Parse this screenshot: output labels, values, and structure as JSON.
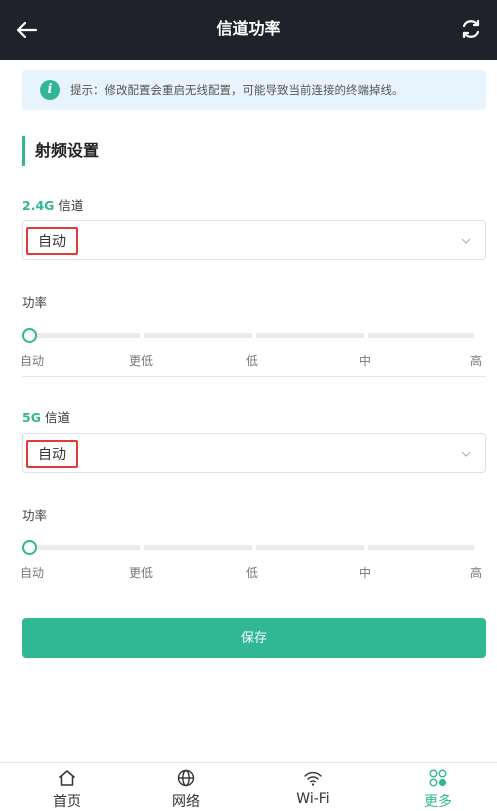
{
  "header": {
    "title": "信道功率",
    "back_icon": "back-arrow-icon",
    "refresh_icon": "refresh-icon"
  },
  "tip": {
    "icon": "info-icon",
    "text": "提示：修改配置会重启无线配置，可能导致当前连接的终端掉线。"
  },
  "section": {
    "title": "射频设置"
  },
  "band24": {
    "band": "2.4G",
    "label_suffix": "信道",
    "channel_value": "自动",
    "power_label": "功率",
    "power_level": 0,
    "power_ticks": [
      "自动",
      "更低",
      "低",
      "中",
      "高"
    ]
  },
  "band5": {
    "band": "5G",
    "label_suffix": "信道",
    "channel_value": "自动",
    "power_label": "功率",
    "power_level": 0,
    "power_ticks": [
      "自动",
      "更低",
      "低",
      "中",
      "高"
    ]
  },
  "save_label": "保存",
  "tabs": [
    {
      "label": "首页",
      "icon": "home-icon",
      "active": false
    },
    {
      "label": "网络",
      "icon": "globe-icon",
      "active": false
    },
    {
      "label": "Wi-Fi",
      "icon": "wifi-icon",
      "active": false
    },
    {
      "label": "更多",
      "icon": "more-grid-icon",
      "active": true
    }
  ],
  "colors": {
    "accent": "#2fb893",
    "header_bg": "#1f2329",
    "highlight": "#e53935"
  }
}
